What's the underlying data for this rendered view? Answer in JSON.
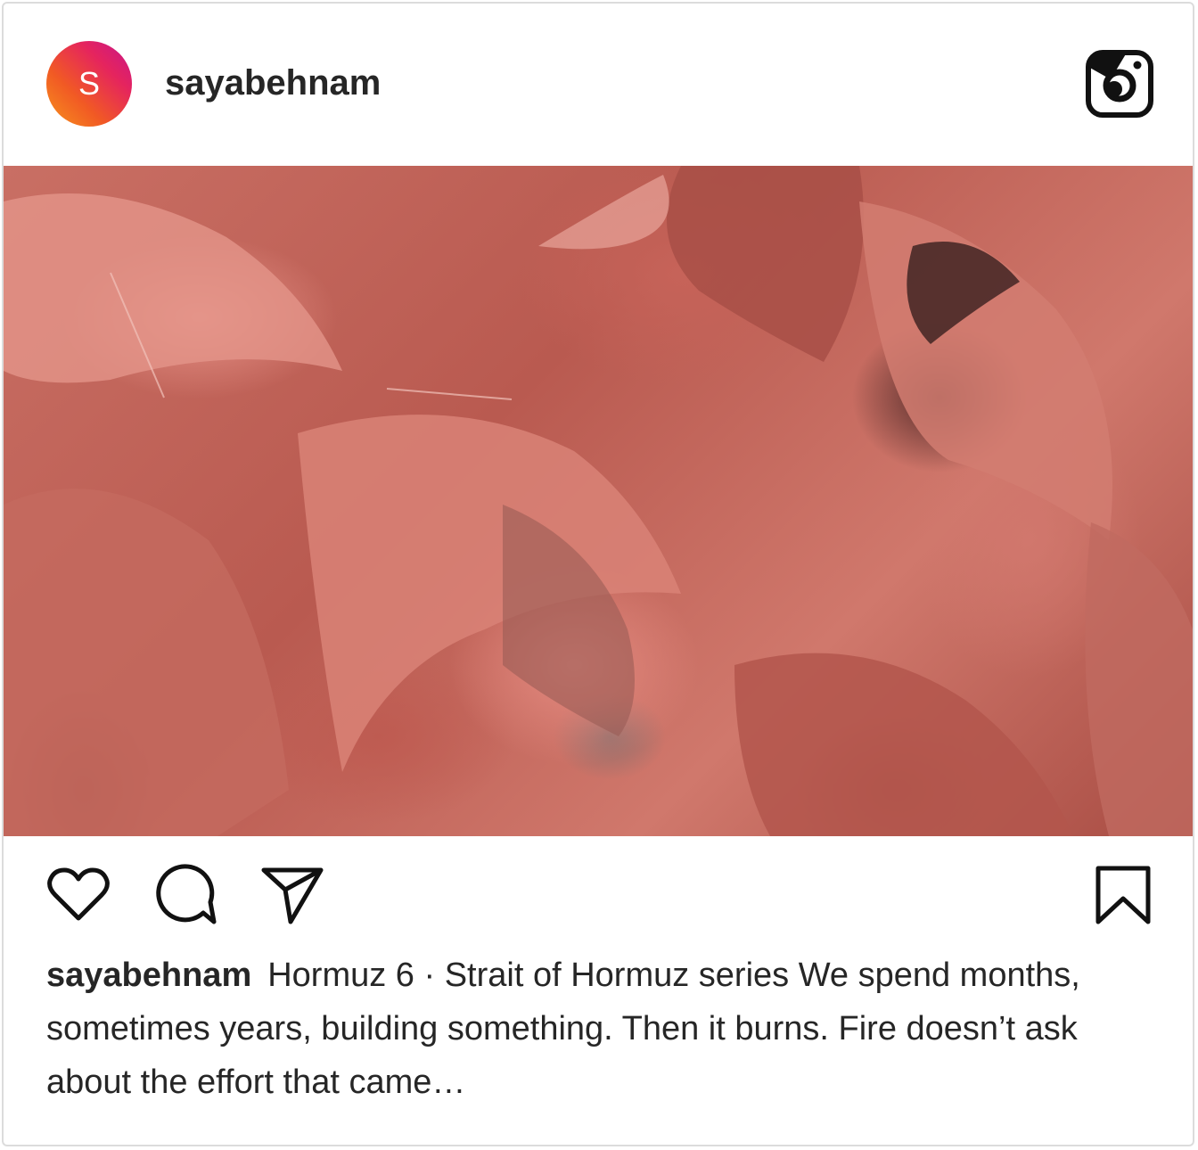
{
  "post": {
    "avatar_letter": "S",
    "username": "sayabehnam",
    "caption_username": "sayabehnam",
    "caption_text": "Hormuz 6 · Strait of Hormuz series We spend months, sometimes years, building something. Then it burns. Fire doesn’t ask about the effort that came…"
  },
  "icons": {
    "platform": "instagram-icon",
    "like": "heart-icon",
    "comment": "comment-icon",
    "share": "share-icon",
    "save": "bookmark-icon"
  },
  "colors": {
    "text": "#262626",
    "avatar_gradient_start": "#f7941d",
    "avatar_gradient_end": "#c6158d"
  }
}
